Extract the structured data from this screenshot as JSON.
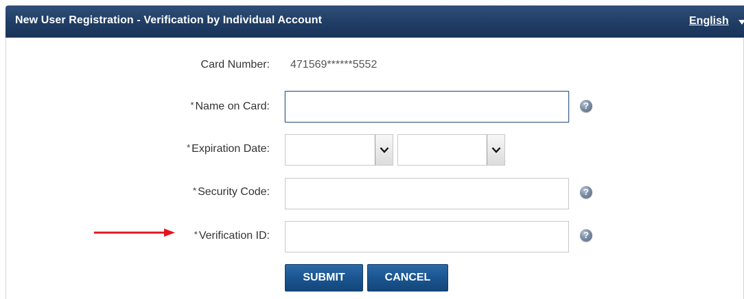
{
  "header": {
    "title": "New User Registration - Verification by Individual Account",
    "language": "English"
  },
  "form": {
    "card_number_label": "Card Number:",
    "card_number_value": "471569******5552",
    "required_marker": "*",
    "name_on_card_label": "Name on Card:",
    "name_on_card_value": "",
    "expiration_date_label": "Expiration Date:",
    "expiration_month_value": "",
    "expiration_year_value": "",
    "security_code_label": "Security Code:",
    "security_code_value": "",
    "verification_id_label": "Verification ID:",
    "verification_id_value": "",
    "help_glyph": "?"
  },
  "actions": {
    "submit_label": "SUBMIT",
    "cancel_label": "CANCEL"
  },
  "icons": {
    "help": "question-mark-icon",
    "dropdown": "chevron-down-icon",
    "language_caret": "caret-down-icon",
    "annotation": "red-arrow-icon"
  },
  "colors": {
    "header_bg": "#203d64",
    "button_bg": "#1b5590",
    "annotation_arrow": "#e3141b"
  }
}
